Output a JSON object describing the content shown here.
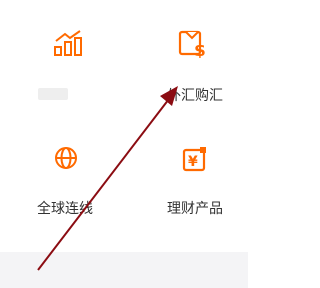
{
  "menu": {
    "items": [
      {
        "label": "",
        "icon": "bar-chart-growth-icon"
      },
      {
        "label": "外汇购汇",
        "icon": "currency-exchange-icon"
      },
      {
        "label": "全球连线",
        "icon": "globe-icon"
      },
      {
        "label": "理财产品",
        "icon": "wealth-product-icon"
      }
    ]
  },
  "colors": {
    "accent": "#ff6a00",
    "arrow": "#8b0c12",
    "text": "#333333",
    "band": "#f4f4f6"
  }
}
